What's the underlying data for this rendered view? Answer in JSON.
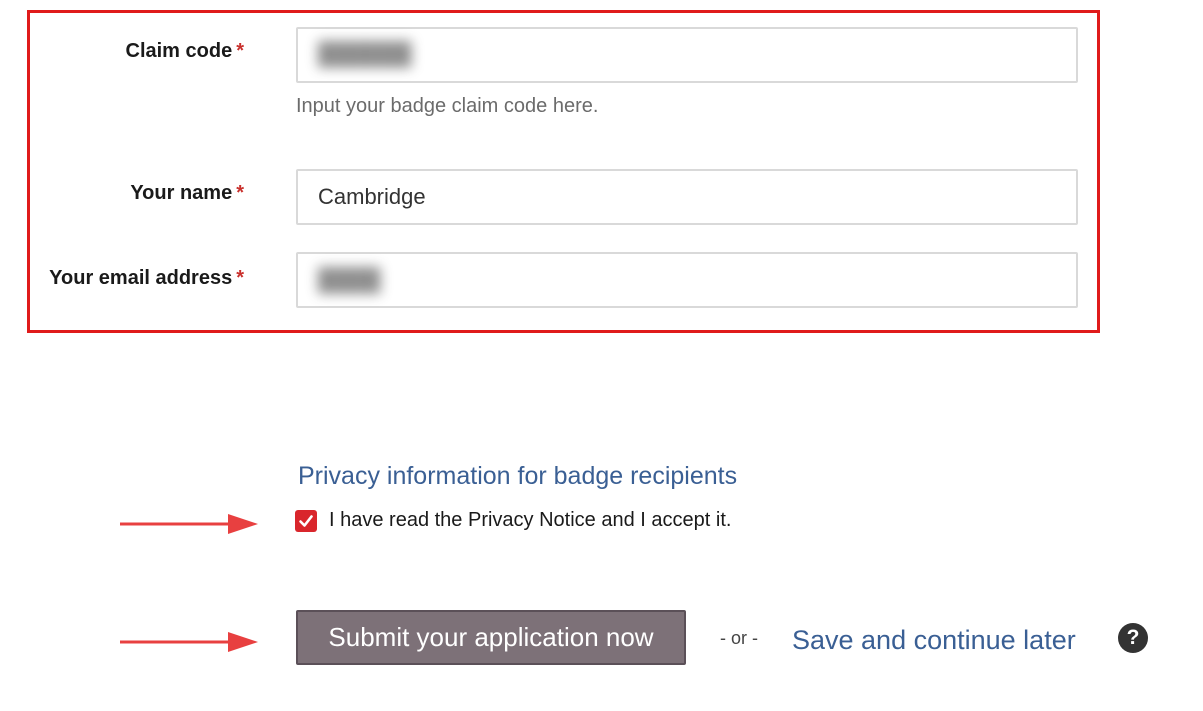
{
  "form": {
    "claim_code": {
      "label": "Claim code",
      "required_mark": "*",
      "help": "Input your badge claim code here."
    },
    "name": {
      "label": "Your name",
      "required_mark": "*",
      "value": "Cambridge"
    },
    "email": {
      "label": "Your email address",
      "required_mark": "*"
    }
  },
  "privacy": {
    "link_text": "Privacy information for badge recipients",
    "checkbox_label": "I have read the Privacy Notice and I accept it.",
    "checked": true
  },
  "actions": {
    "submit_label": "Submit your application now",
    "or_text": "- or -",
    "save_label": "Save and continue later",
    "help_icon_glyph": "?"
  },
  "colors": {
    "highlight": "#e01b1b",
    "required": "#c9302c",
    "link": "#3a5f94",
    "checkbox": "#d9262c",
    "submit_bg": "#7d7178",
    "arrow": "#e84040"
  }
}
